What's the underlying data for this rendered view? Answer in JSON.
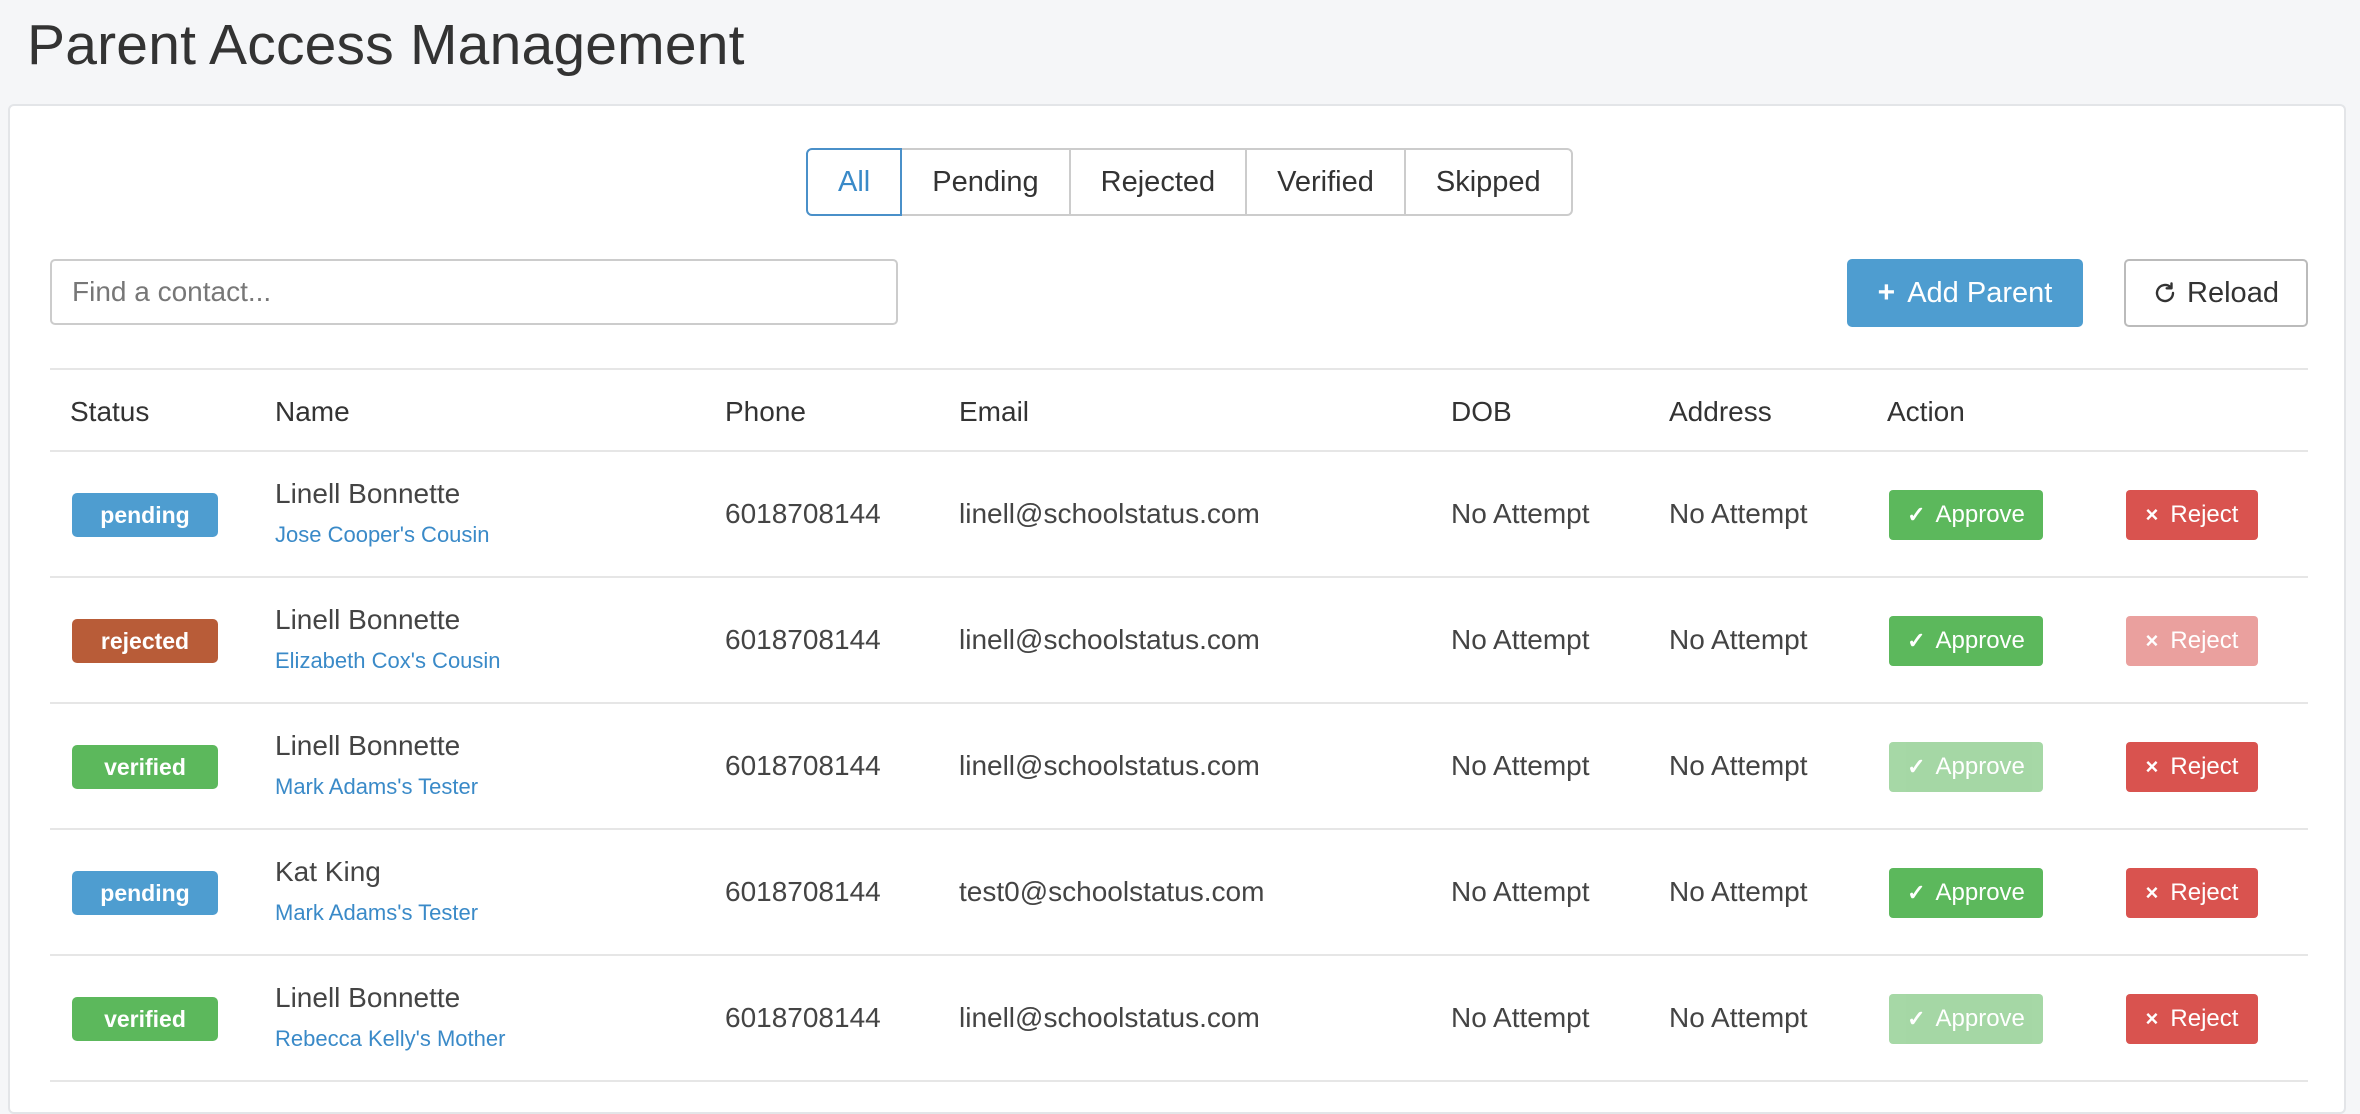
{
  "page": {
    "title": "Parent Access Management"
  },
  "tabs": [
    {
      "label": "All",
      "active": true
    },
    {
      "label": "Pending",
      "active": false
    },
    {
      "label": "Rejected",
      "active": false
    },
    {
      "label": "Verified",
      "active": false
    },
    {
      "label": "Skipped",
      "active": false
    }
  ],
  "search": {
    "placeholder": "Find a contact...",
    "value": ""
  },
  "toolbar": {
    "add_label": "Add Parent",
    "reload_label": "Reload"
  },
  "table": {
    "headers": [
      "Status",
      "Name",
      "Phone",
      "Email",
      "DOB",
      "Address",
      "Action"
    ],
    "rows": [
      {
        "status": "pending",
        "name": "Linell Bonnette",
        "relation": "Jose Cooper's Cousin",
        "phone": "6018708144",
        "email": "linell@schoolstatus.com",
        "dob": "No Attempt",
        "address": "No Attempt",
        "approve": "Approve",
        "reject": "Reject",
        "approve_enabled": true,
        "reject_enabled": true
      },
      {
        "status": "rejected",
        "name": "Linell Bonnette",
        "relation": "Elizabeth Cox's Cousin",
        "phone": "6018708144",
        "email": "linell@schoolstatus.com",
        "dob": "No Attempt",
        "address": "No Attempt",
        "approve": "Approve",
        "reject": "Reject",
        "approve_enabled": true,
        "reject_enabled": false
      },
      {
        "status": "verified",
        "name": "Linell Bonnette",
        "relation": "Mark Adams's Tester",
        "phone": "6018708144",
        "email": "linell@schoolstatus.com",
        "dob": "No Attempt",
        "address": "No Attempt",
        "approve": "Approve",
        "reject": "Reject",
        "approve_enabled": false,
        "reject_enabled": true
      },
      {
        "status": "pending",
        "name": "Kat King",
        "relation": "Mark Adams's Tester",
        "phone": "6018708144",
        "email": "test0@schoolstatus.com",
        "dob": "No Attempt",
        "address": "No Attempt",
        "approve": "Approve",
        "reject": "Reject",
        "approve_enabled": true,
        "reject_enabled": true
      },
      {
        "status": "verified",
        "name": "Linell Bonnette",
        "relation": "Rebecca Kelly's Mother",
        "phone": "6018708144",
        "email": "linell@schoolstatus.com",
        "dob": "No Attempt",
        "address": "No Attempt",
        "approve": "Approve",
        "reject": "Reject",
        "approve_enabled": false,
        "reject_enabled": true
      }
    ]
  },
  "colors": {
    "pending": "#4e9dd0",
    "rejected": "#b85c38",
    "verified": "#5cb85c",
    "approve": "#5cb85c",
    "reject": "#d9534f",
    "link": "#3a8ac8"
  },
  "icons": {
    "add": "plus-icon",
    "reload": "reload-icon",
    "approve": "check-icon",
    "reject": "x-icon"
  }
}
